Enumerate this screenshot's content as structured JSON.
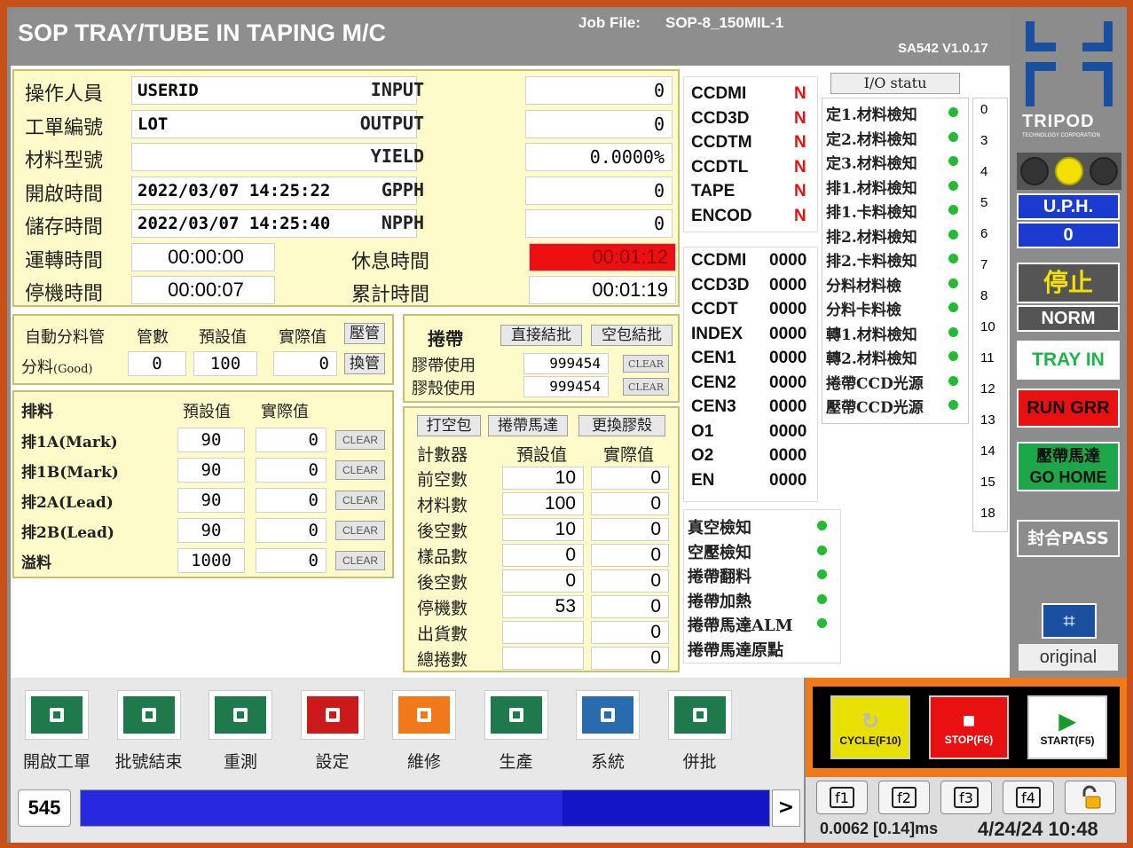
{
  "header": {
    "title": "SOP TRAY/TUBE IN TAPING M/C",
    "job_label": "Job File:",
    "job_value": "SOP-8_150MIL-1",
    "version": "SA542  V1.0.17"
  },
  "info": [
    {
      "label": "操作人員",
      "value": "USERID"
    },
    {
      "label": "工單編號",
      "value": "LOT"
    },
    {
      "label": "材料型號",
      "value": ""
    },
    {
      "label": "開啟時間",
      "value": "2022/03/07  14:25:22"
    },
    {
      "label": "儲存時間",
      "value": "2022/03/07  14:25:40"
    },
    {
      "label": "運轉時間",
      "value": "00:00:00"
    },
    {
      "label": "停機時間",
      "value": "00:00:07"
    }
  ],
  "stats": [
    {
      "label": "INPUT",
      "value": "0"
    },
    {
      "label": "OUTPUT",
      "value": "0"
    },
    {
      "label": "YIELD",
      "value": "0.0000%"
    },
    {
      "label": "GPPH",
      "value": "0"
    },
    {
      "label": "NPPH",
      "value": "0"
    },
    {
      "label": "休息時間",
      "value": "00:01:12",
      "alert": true
    },
    {
      "label": "累計時間",
      "value": "00:01:19"
    }
  ],
  "tube": {
    "h1": "自動分料管",
    "h2": "管數",
    "h3": "預設值",
    "h4": "實際值",
    "btn1": "壓管",
    "row_label": "分料",
    "row_sub": "(Good)",
    "count": "0",
    "preset": "100",
    "actual": "0",
    "btn2": "換管"
  },
  "reject": {
    "h1": "排料",
    "h2": "預設值",
    "h3": "實際值",
    "clear": "CLEAR",
    "rows": [
      {
        "label": "排1A(Mark)",
        "preset": "90",
        "actual": "0"
      },
      {
        "label": "排1B(Mark)",
        "preset": "90",
        "actual": "0"
      },
      {
        "label": "排2A(Lead)",
        "preset": "90",
        "actual": "0"
      },
      {
        "label": "排2B(Lead)",
        "preset": "90",
        "actual": "0"
      },
      {
        "label": "溢料",
        "preset": "1000",
        "actual": "0"
      }
    ]
  },
  "tape": {
    "label": "捲帶",
    "btn1": "直接結批",
    "btn2": "空包結批",
    "rows": [
      {
        "label": "膠帶使用",
        "value": "999454"
      },
      {
        "label": "膠殼使用",
        "value": "999454"
      }
    ],
    "clear": "CLEAR"
  },
  "counter": {
    "btn1": "打空包",
    "btn2": "捲帶馬達",
    "btn3": "更換膠殼",
    "h1": "計數器",
    "h2": "預設值",
    "h3": "實際值",
    "rows": [
      {
        "label": "前空數",
        "preset": "10",
        "actual": "0"
      },
      {
        "label": "材料數",
        "preset": "100",
        "actual": "0"
      },
      {
        "label": "後空數",
        "preset": "10",
        "actual": "0"
      },
      {
        "label": "樣品數",
        "preset": "0",
        "actual": "0"
      },
      {
        "label": "後空數",
        "preset": "0",
        "actual": "0"
      },
      {
        "label": "停機數",
        "preset": "53",
        "actual": "0"
      },
      {
        "label": "出貨數",
        "preset": "",
        "actual": "0"
      },
      {
        "label": "總捲數",
        "preset": "",
        "actual": "0"
      }
    ]
  },
  "ccd": [
    {
      "name": "CCDMI",
      "v": "N"
    },
    {
      "name": "CCD3D",
      "v": "N"
    },
    {
      "name": "CCDTM",
      "v": "N"
    },
    {
      "name": "CCDTL",
      "v": "N"
    },
    {
      "name": "TAPE",
      "v": "N"
    },
    {
      "name": "ENCOD",
      "v": "N"
    }
  ],
  "codes": [
    {
      "name": "CCDMI",
      "v": "0000"
    },
    {
      "name": "CCD3D",
      "v": "0000"
    },
    {
      "name": "CCDT",
      "v": "0000"
    },
    {
      "name": "INDEX",
      "v": "0000"
    },
    {
      "name": "CEN1",
      "v": "0000"
    },
    {
      "name": "CEN2",
      "v": "0000"
    },
    {
      "name": "CEN3",
      "v": "0000"
    },
    {
      "name": "O1",
      "v": "0000"
    },
    {
      "name": "O2",
      "v": "0000"
    },
    {
      "name": "EN",
      "v": "0000"
    }
  ],
  "vac": [
    {
      "label": "真空檢知",
      "on": true
    },
    {
      "label": "空壓檢知",
      "on": true
    },
    {
      "label": "捲帶翻料",
      "on": true
    },
    {
      "label": "捲帶加熱",
      "on": true
    },
    {
      "label": "捲帶馬達ALM",
      "on": true
    },
    {
      "label": "捲帶馬達原點",
      "on": false
    }
  ],
  "io": {
    "btn": "I/O statu",
    "items": [
      "定1.材料檢知",
      "定2.材料檢知",
      "定3.材料檢知",
      "排1.材料檢知",
      "排1.卡料檢知",
      "排2.材料檢知",
      "排2.卡料檢知",
      "分料材料檢",
      "分料卡料檢",
      "轉1.材料檢知",
      "轉2.材料檢知",
      "捲帶CCD光源",
      "壓帶CCD光源"
    ],
    "nums": [
      "0",
      "3",
      "4",
      "5",
      "6",
      "7",
      "8",
      "10",
      "11",
      "12",
      "13",
      "14",
      "15",
      "18"
    ]
  },
  "side": {
    "logo": "TRIPOD",
    "logo_sub": "TECHNOLOGY CORPORATION",
    "uph_label": "U.P.H.",
    "uph_value": "0",
    "stop": "停止",
    "norm": "NORM",
    "tray": "TRAY  IN",
    "run": "RUN GRR",
    "home1": "壓帶馬達",
    "home2": "GO HOME",
    "pass": "封合PASS",
    "original": "original"
  },
  "toolbar": [
    {
      "label": "開啟工單",
      "icon": "document-icon",
      "color": "#1e7a4a"
    },
    {
      "label": "批號結束",
      "icon": "save-icon",
      "color": "#1e7a4a"
    },
    {
      "label": "重測",
      "icon": "chip-icon",
      "color": "#1e7a4a"
    },
    {
      "label": "設定",
      "icon": "hand-pointer-icon",
      "color": "#cc1a1a"
    },
    {
      "label": "維修",
      "icon": "tools-icon",
      "color": "#f07a1a"
    },
    {
      "label": "生產",
      "icon": "clipboard-icon",
      "color": "#1e7a4a"
    },
    {
      "label": "系統",
      "icon": "monitor-icon",
      "color": "#2a6bb0"
    },
    {
      "label": "併批",
      "icon": "folder-icon",
      "color": "#1e7a4a"
    }
  ],
  "progress": {
    "count": "545",
    "arrow": ">",
    "fill": 0.7
  },
  "controls": [
    {
      "label": "CYCLE(F10)",
      "color": "#e8e000"
    },
    {
      "label": "STOP(F6)",
      "color": "#e81010"
    },
    {
      "label": "START(F5)",
      "color": "#ffffff"
    }
  ],
  "fkeys": [
    "f1",
    "f2",
    "f3",
    "f4"
  ],
  "status": {
    "timing": "0.0062 [0.14]ms",
    "datetime": "4/24/24 10:48"
  }
}
